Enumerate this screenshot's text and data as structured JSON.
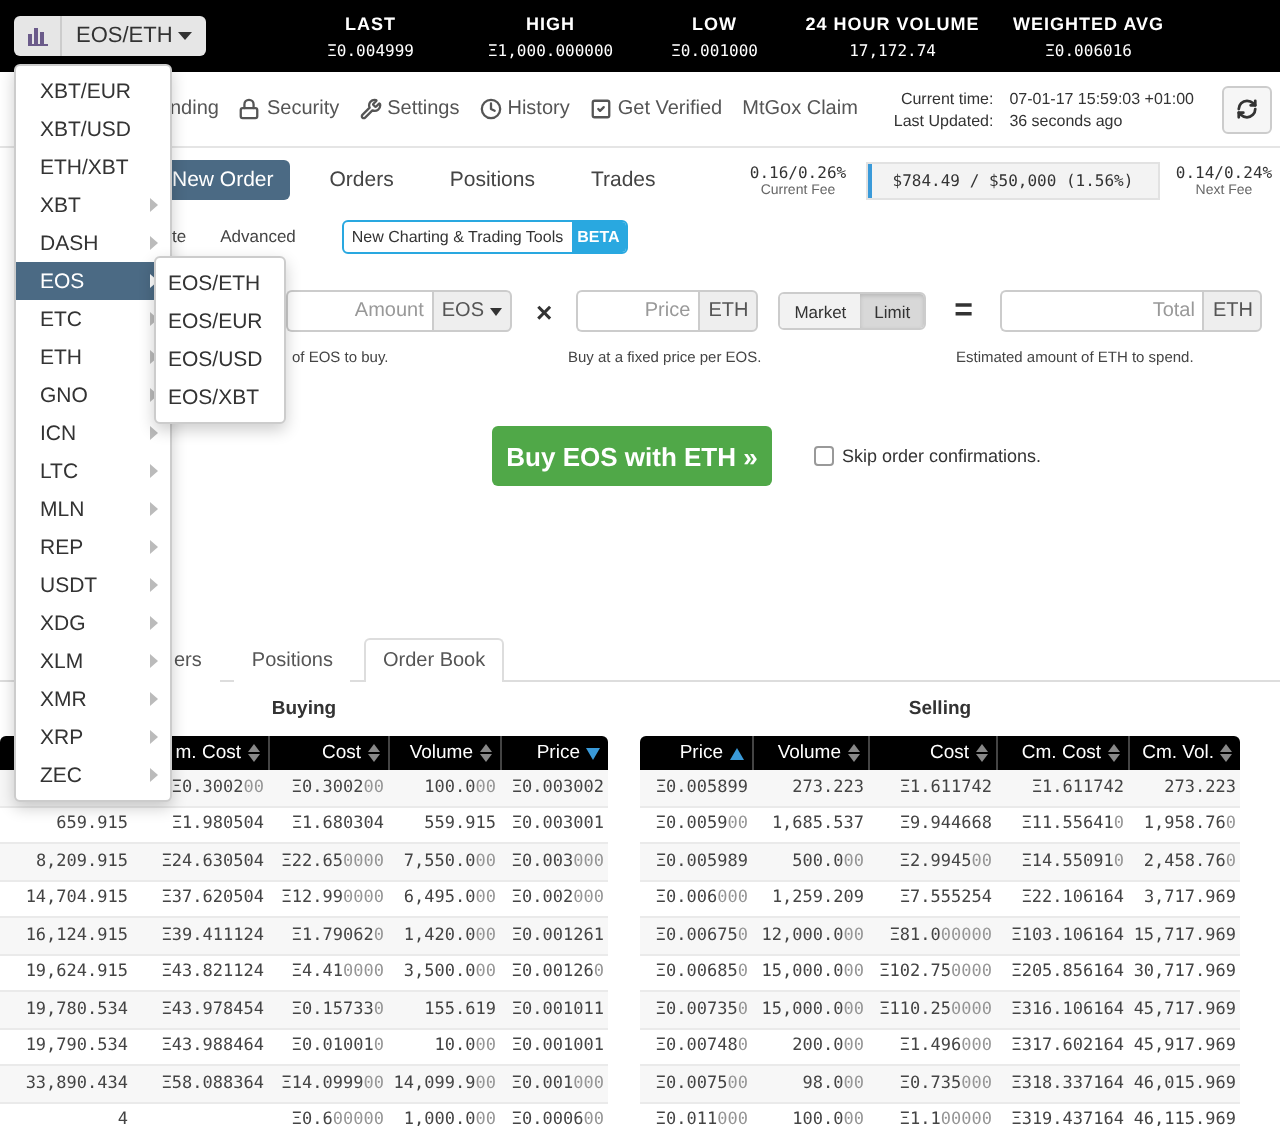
{
  "top_bar": {
    "pair_button": "EOS/ETH",
    "stats": [
      {
        "label": "LAST",
        "value": "Ξ0.004999"
      },
      {
        "label": "HIGH",
        "value": "Ξ1,000.000000"
      },
      {
        "label": "LOW",
        "value": "Ξ0.001000"
      },
      {
        "label": "24 HOUR VOLUME",
        "value": "17,172.74"
      },
      {
        "label": "WEIGHTED AVG",
        "value": "Ξ0.006016"
      }
    ]
  },
  "pair_menu": {
    "items": [
      {
        "label": "XBT/EUR",
        "kind": "pair",
        "selected": false
      },
      {
        "label": "XBT/USD",
        "kind": "pair",
        "selected": false
      },
      {
        "label": "ETH/XBT",
        "kind": "pair",
        "selected": false
      },
      {
        "label": "XBT",
        "kind": "group",
        "selected": false
      },
      {
        "label": "DASH",
        "kind": "group",
        "selected": false
      },
      {
        "label": "EOS",
        "kind": "group",
        "selected": true,
        "children": [
          "EOS/ETH",
          "EOS/EUR",
          "EOS/USD",
          "EOS/XBT"
        ]
      },
      {
        "label": "ETC",
        "kind": "group",
        "selected": false
      },
      {
        "label": "ETH",
        "kind": "group",
        "selected": false
      },
      {
        "label": "GNO",
        "kind": "group",
        "selected": false
      },
      {
        "label": "ICN",
        "kind": "group",
        "selected": false
      },
      {
        "label": "LTC",
        "kind": "group",
        "selected": false
      },
      {
        "label": "MLN",
        "kind": "group",
        "selected": false
      },
      {
        "label": "REP",
        "kind": "group",
        "selected": false
      },
      {
        "label": "USDT",
        "kind": "group",
        "selected": false
      },
      {
        "label": "XDG",
        "kind": "group",
        "selected": false
      },
      {
        "label": "XLM",
        "kind": "group",
        "selected": false
      },
      {
        "label": "XMR",
        "kind": "group",
        "selected": false
      },
      {
        "label": "XRP",
        "kind": "group",
        "selected": false
      },
      {
        "label": "ZEC",
        "kind": "group",
        "selected": false
      }
    ]
  },
  "nav": {
    "links": [
      "nding",
      "Security",
      "Settings",
      "History",
      "Get Verified",
      "MtGox Claim"
    ],
    "current_time_label": "Current time:",
    "current_time": "07-01-17 15:59:03 +01:00",
    "last_updated_label": "Last Updated:",
    "last_updated": "36 seconds ago"
  },
  "order_tabs": [
    {
      "label": "New Order",
      "selected": true
    },
    {
      "label": "Orders",
      "selected": false
    },
    {
      "label": "Positions",
      "selected": false
    },
    {
      "label": "Trades",
      "selected": false
    }
  ],
  "fees": {
    "current": "0.16/0.26%",
    "current_label": "Current Fee",
    "volume": "$784.49 / $50,000 (1.56%)",
    "level": 0.0156,
    "next": "0.14/0.24%",
    "next_label": "Next Fee"
  },
  "mode_links": [
    "te",
    "Advanced"
  ],
  "charting_button": {
    "label": "New Charting & Trading Tools",
    "badge": "BETA"
  },
  "form": {
    "amount": {
      "placeholder": "Amount",
      "unit": "EOS",
      "hint": "of EOS to buy."
    },
    "times": "×",
    "price": {
      "placeholder": "Price",
      "unit": "ETH",
      "hint": "Buy at a fixed price per EOS."
    },
    "order_types": [
      {
        "label": "Market",
        "selected": false
      },
      {
        "label": "Limit",
        "selected": true
      }
    ],
    "equals": "=",
    "total": {
      "placeholder": "Total",
      "unit": "ETH",
      "hint": "Estimated amount of ETH to spend."
    }
  },
  "submit": "Buy EOS with ETH »",
  "skip_confirm": {
    "label": "Skip order confirmations.",
    "checked": false
  },
  "book_tabs": [
    {
      "label": "ers",
      "selected": false
    },
    {
      "label": "Positions",
      "selected": false
    },
    {
      "label": "Order Book",
      "selected": true
    }
  ],
  "buying": {
    "title": "Buying",
    "columns": [
      {},
      {
        "label": "m. Cost",
        "sorted": false
      },
      {
        "label": "Cost",
        "sorted": false
      },
      {
        "label": "Volume",
        "sorted": false
      },
      {
        "label": "Price",
        "sorted": true,
        "descending": true
      }
    ],
    "rows": [
      [
        "",
        "Ξ0.300200",
        "Ξ0.300200",
        "100.000",
        "Ξ0.003002"
      ],
      [
        "659.915",
        "Ξ1.980504",
        "Ξ1.680304",
        "559.915",
        "Ξ0.003001"
      ],
      [
        "8,209.915",
        "Ξ24.630504",
        "Ξ22.650000",
        "7,550.000",
        "Ξ0.003000"
      ],
      [
        "14,704.915",
        "Ξ37.620504",
        "Ξ12.990000",
        "6,495.000",
        "Ξ0.002000"
      ],
      [
        "16,124.915",
        "Ξ39.411124",
        "Ξ1.790620",
        "1,420.000",
        "Ξ0.001261"
      ],
      [
        "19,624.915",
        "Ξ43.821124",
        "Ξ4.410000",
        "3,500.000",
        "Ξ0.001260"
      ],
      [
        "19,780.534",
        "Ξ43.978454",
        "Ξ0.157330",
        "155.619",
        "Ξ0.001011"
      ],
      [
        "19,790.534",
        "Ξ43.988464",
        "Ξ0.010010",
        "10.000",
        "Ξ0.001001"
      ],
      [
        "33,890.434",
        "Ξ58.088364",
        "Ξ14.099900",
        "14,099.900",
        "Ξ0.001000"
      ],
      [
        "4",
        "",
        "Ξ0.600000",
        "1,000.000",
        "Ξ0.000600"
      ]
    ]
  },
  "selling": {
    "title": "Selling",
    "columns": [
      {
        "label": "Price",
        "sorted": true,
        "descending": false
      },
      {
        "label": "Volume",
        "sorted": false
      },
      {
        "label": "Cost",
        "sorted": false
      },
      {
        "label": "Cm. Cost",
        "sorted": false
      },
      {
        "label": "Cm. Vol.",
        "sorted": false
      }
    ],
    "rows": [
      [
        "Ξ0.005899",
        "273.223",
        "Ξ1.611742",
        "Ξ1.611742",
        "273.223"
      ],
      [
        "Ξ0.005900",
        "1,685.537",
        "Ξ9.944668",
        "Ξ11.556410",
        "1,958.760"
      ],
      [
        "Ξ0.005989",
        "500.000",
        "Ξ2.994500",
        "Ξ14.550910",
        "2,458.760"
      ],
      [
        "Ξ0.006000",
        "1,259.209",
        "Ξ7.555254",
        "Ξ22.106164",
        "3,717.969"
      ],
      [
        "Ξ0.006750",
        "12,000.000",
        "Ξ81.000000",
        "Ξ103.106164",
        "15,717.969"
      ],
      [
        "Ξ0.006850",
        "15,000.000",
        "Ξ102.750000",
        "Ξ205.856164",
        "30,717.969"
      ],
      [
        "Ξ0.007350",
        "15,000.000",
        "Ξ110.250000",
        "Ξ316.106164",
        "45,717.969"
      ],
      [
        "Ξ0.007480",
        "200.000",
        "Ξ1.496000",
        "Ξ317.602164",
        "45,917.969"
      ],
      [
        "Ξ0.007500",
        "98.000",
        "Ξ0.735000",
        "Ξ318.337164",
        "46,015.969"
      ],
      [
        "Ξ0.011000",
        "100.000",
        "Ξ1.100000",
        "Ξ319.437164",
        "46,115.969"
      ]
    ]
  }
}
